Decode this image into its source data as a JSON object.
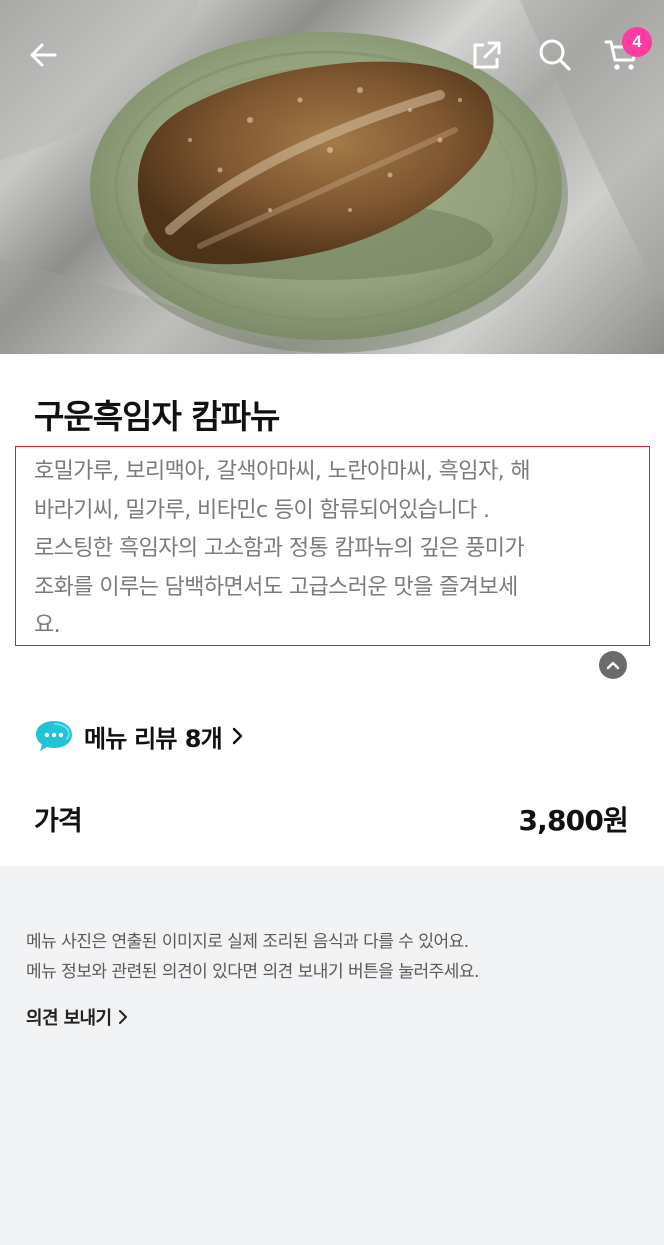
{
  "header": {
    "cart_count": "4",
    "icons": [
      "back-arrow-icon",
      "share-icon",
      "search-icon",
      "cart-icon"
    ]
  },
  "product": {
    "name": "구운흑임자 캄파뉴",
    "description_lines": [
      "호밀가루, 보리맥아, 갈색아마씨, 노란아마씨, 흑임자, 해",
      "바라기씨, 밀가루, 비타민c 등이 함류되어있습니다 .",
      "로스팅한 흑임자의 고소함과 정통 캄파뉴의 깊은 풍미가",
      "조화를 이루는  담백하면서도 고급스러운 맛을 즐겨보세",
      "요."
    ]
  },
  "review": {
    "label": "메뉴 리뷰",
    "count": "8개"
  },
  "price": {
    "label": "가격",
    "value": "3,800원"
  },
  "footer": {
    "notice_line1": "메뉴 사진은 연출된 이미지로 실제 조리된 음식과 다를 수 있어요.",
    "notice_line2": "메뉴 정보와 관련된 의견이 있다면 의견 보내기 버튼을 눌러주세요.",
    "feedback_label": "의견 보내기"
  },
  "colors": {
    "badge": "#ff3aa0",
    "highlight_border": "#e01e2b",
    "chat_icon": "#22c3d6",
    "plate": "#8fa07a"
  }
}
